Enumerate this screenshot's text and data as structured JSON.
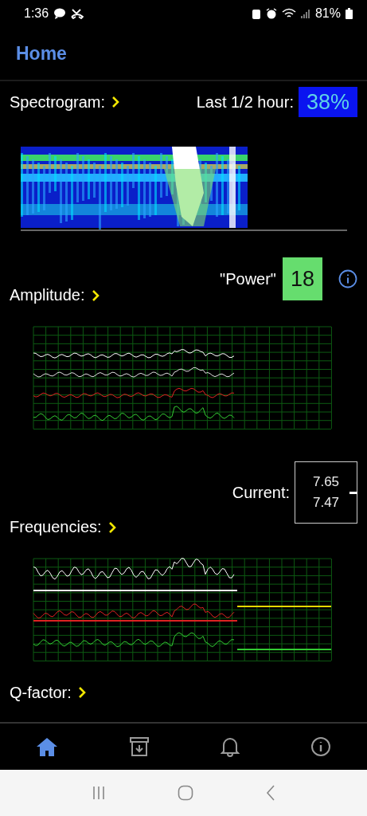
{
  "status_bar": {
    "time": "1:36",
    "battery": "81%"
  },
  "header": {
    "title": "Home"
  },
  "spectrogram": {
    "label": "Spectrogram:",
    "reading_label": "Last 1/2 hour:",
    "reading": "38%"
  },
  "amplitude": {
    "label": "Amplitude:",
    "reading_label": "\"Power\"",
    "reading": "18"
  },
  "frequencies": {
    "label": "Frequencies:",
    "reading_label": "Current:",
    "readings": [
      "7.65",
      "7.47"
    ]
  },
  "q_factor": {
    "label": "Q-factor:"
  },
  "bottom_nav": [
    {
      "kind": "home",
      "selected": true
    },
    {
      "kind": "archive",
      "selected": false
    },
    {
      "kind": "bell",
      "selected": false
    },
    {
      "kind": "info",
      "selected": false
    }
  ]
}
